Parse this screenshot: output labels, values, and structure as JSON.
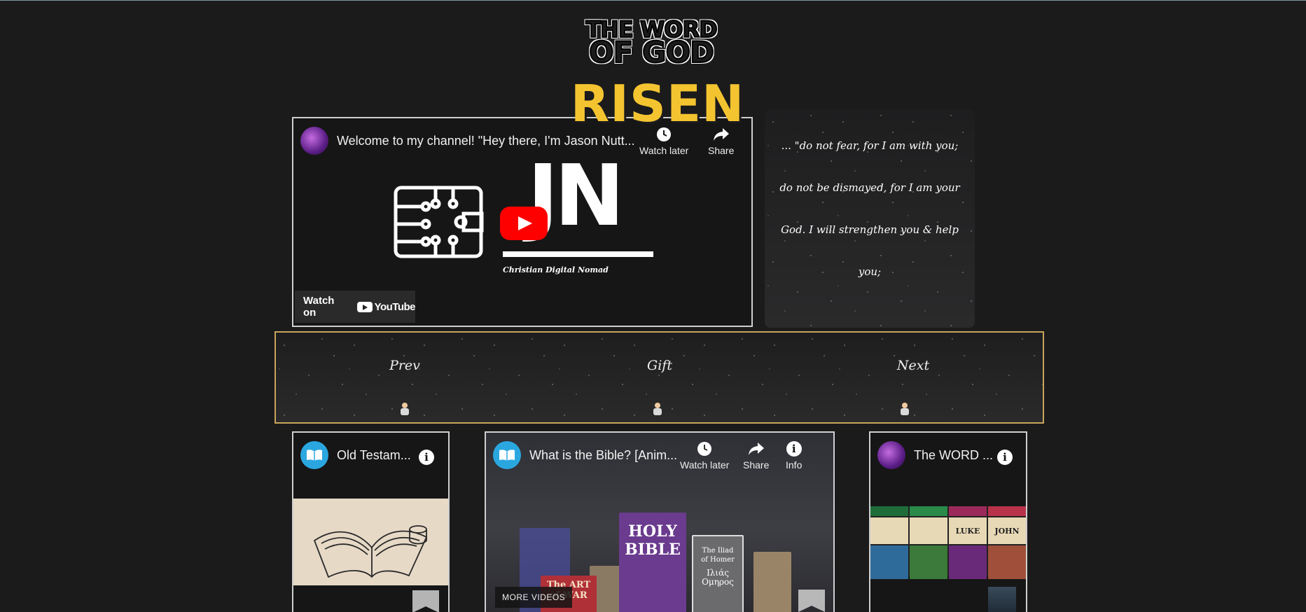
{
  "logo": {
    "line1": "THE WORD",
    "line2": "OF GOD",
    "subtitle": "RISEN",
    "accent_color": "#f4c430"
  },
  "main_video": {
    "title": "Welcome to my channel! \"Hey there, I'm Jason Nutt...",
    "watch_later": "Watch later",
    "share": "Share",
    "watch_on": "Watch on",
    "youtube": "YouTube",
    "thumbnail_text": "JN",
    "thumbnail_caption": "Christian Digital Nomad",
    "icons": [
      "clock-icon",
      "share-icon",
      "play-icon",
      "circuit-icon"
    ]
  },
  "verse": {
    "text": "... \"do not fear, for I am with you; do not be dismayed, for I am your God. I will strengthen you & help you;"
  },
  "nav": {
    "prev": "Prev",
    "gift": "Gift",
    "next": "Next",
    "border_color": "#c8a55a"
  },
  "videos": [
    {
      "title": "Old Testam...",
      "icons": [
        "bible-icon",
        "info-icon",
        "bookmark-icon"
      ]
    },
    {
      "title": "What is the Bible? [Anim...",
      "watch_later": "Watch later",
      "share": "Share",
      "info": "Info",
      "more_videos": "MORE VIDEOS",
      "books": {
        "holy_bible": "HOLY BIBLE",
        "iliad_line1": "The Iliad",
        "iliad_line2": "of Homer",
        "iliad_line3": "Ιλιάς",
        "iliad_line4": "Ομηρος",
        "art_of_war": "The ART of WAR"
      }
    },
    {
      "title": "The WORD ...",
      "grid_labels": [
        "LUKE",
        "JOHN"
      ],
      "icons": [
        "info-icon"
      ]
    }
  ]
}
